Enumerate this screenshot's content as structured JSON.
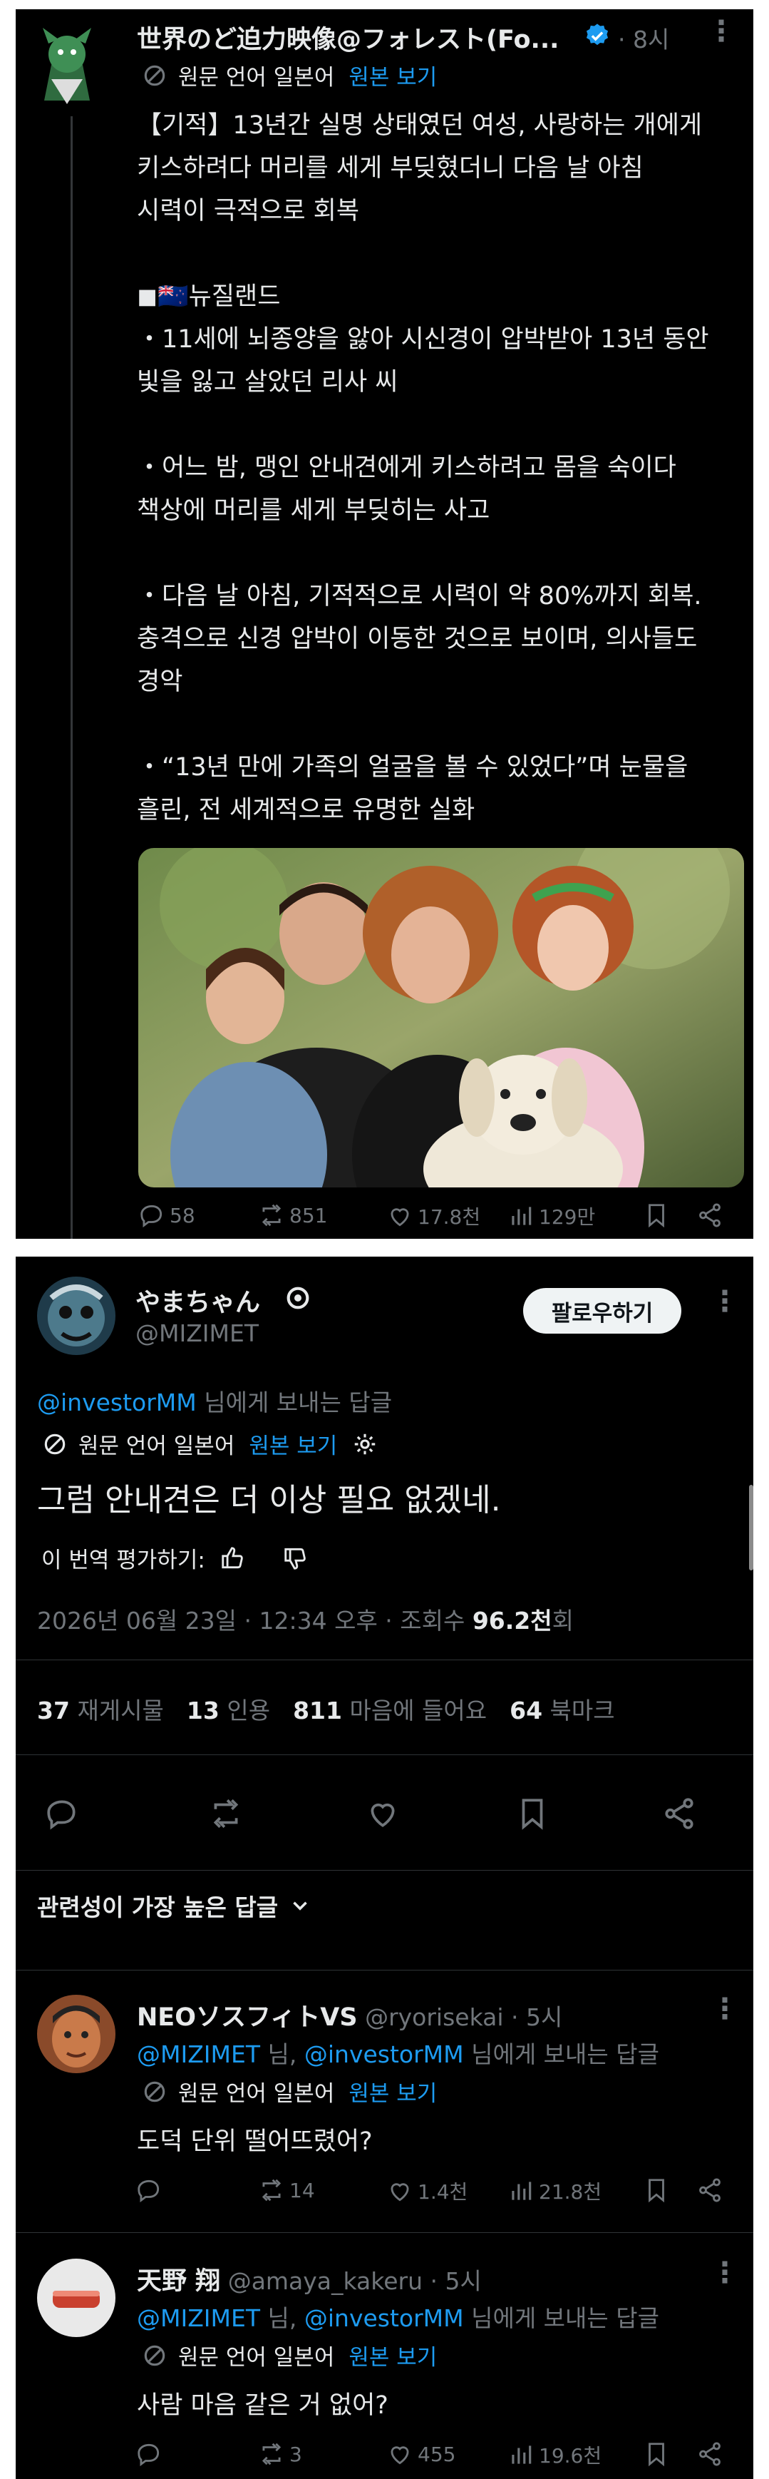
{
  "tweet1": {
    "author": "世界のど迫力映像@フォレスト(Fo...",
    "time": "· 8시",
    "translation_note": "원문 언어 일본어",
    "view_original": "원본 보기",
    "body_lines": [
      "【기적】13년간 실명 상태였던 여성, 사랑하는 개에게",
      "키스하려다 머리를 세게 부딪혔더니 다음 날 아침",
      "시력이 극적으로 회복",
      "",
      "◼︎🇳🇿뉴질랜드",
      "・11세에 뇌종양을 앓아 시신경이 압박받아 13년 동안",
      "빛을 잃고 살았던 리사 씨",
      "",
      "・어느 밤, 맹인 안내견에게 키스하려고 몸을 숙이다",
      "책상에 머리를 세게 부딪히는 사고",
      "",
      "・다음 날 아침, 기적적으로 시력이 약 80%까지 회복.",
      "충격으로 신경 압박이 이동한 것으로 보이며, 의사들도",
      "경악",
      "",
      "・“13년 만에 가족의 얼굴을 볼 수 있었다”며 눈물을",
      "흘린, 전 세계적으로 유명한 실화"
    ],
    "stats": {
      "replies": "58",
      "retweets": "851",
      "likes": "17.8천",
      "views": "129만"
    }
  },
  "tweet2": {
    "author": "やまちゃん",
    "handle": "@MIZIMET",
    "follow_label": "팔로우하기",
    "reply_to_handle": "@investorMM",
    "reply_to_suffix": " 님에게 보내는 답글",
    "translation_note": "원문 언어 일본어",
    "view_original": "원본 보기",
    "body": "그럼 안내견은 더 이상 필요 없겠네.",
    "rate_label": "이 번역 평가하기:",
    "datetime": "2026년 06월 23일 · 12:34 오후 · 조회수 ",
    "views_count": "96.2천",
    "views_suffix": "회",
    "counts": [
      {
        "num": "37",
        "label": "재게시물"
      },
      {
        "num": "13",
        "label": "인용"
      },
      {
        "num": "811",
        "label": "마음에 들어요"
      },
      {
        "num": "64",
        "label": "북마크"
      }
    ],
    "sort_label": "관련성이 가장 높은 답글"
  },
  "replies": [
    {
      "author": "NEOソスフィトVS",
      "handle": "@ryorisekai",
      "time": "· 5시",
      "mention1": "@MIZIMET",
      "mid": " 님, ",
      "mention2": "@investorMM",
      "suffix": " 님에게 보내는 답글",
      "translation_note": "원문 언어 일본어",
      "view_original": "원본 보기",
      "body": "도덕 단위 떨어뜨렸어?",
      "stats": {
        "retweets": "14",
        "likes": "1.4천",
        "views": "21.8천"
      }
    },
    {
      "author": "天野 翔",
      "handle": "@amaya_kakeru",
      "time": "· 5시",
      "mention1": "@MIZIMET",
      "mid": " 님, ",
      "mention2": "@investorMM",
      "suffix": " 님에게 보내는 답글",
      "translation_note": "원문 언어 일본어",
      "view_original": "원본 보기",
      "body": "사람 마음 같은 거 없어?",
      "stats": {
        "retweets": "3",
        "likes": "455",
        "views": "19.6천"
      }
    }
  ],
  "colors": {
    "background": "#000000",
    "text": "#e7e9ea",
    "muted": "#71767b",
    "link": "#1d9bf0",
    "verified": "#1d9bf0"
  }
}
